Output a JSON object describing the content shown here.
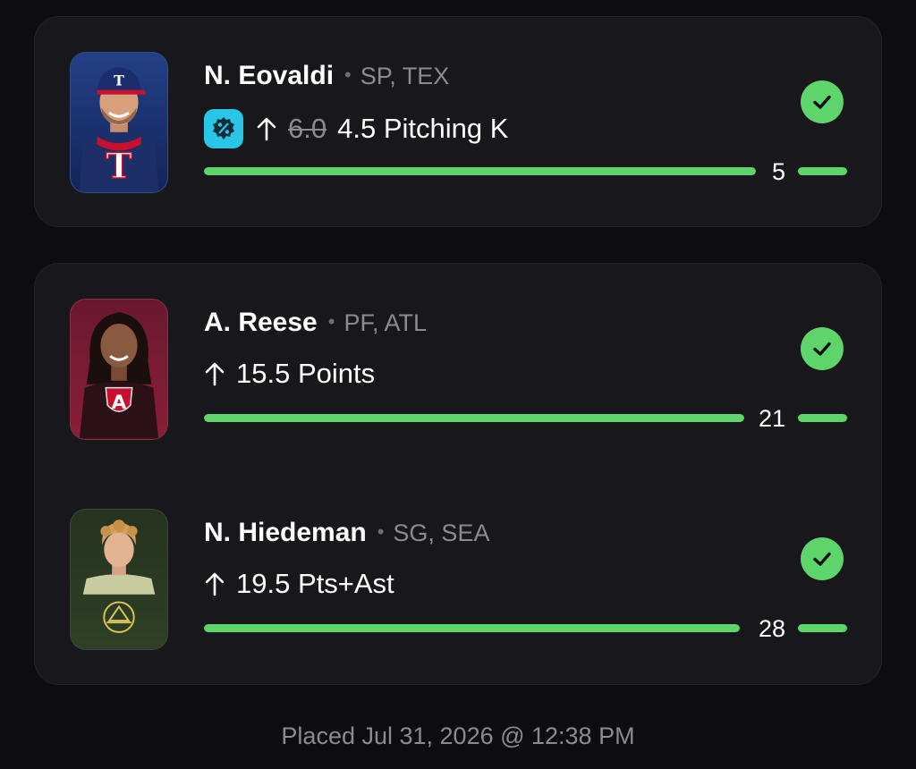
{
  "picks": [
    {
      "name": "N. Eovaldi",
      "meta": "SP, TEX",
      "promo_icon": "discount-badge-icon",
      "direction_icon": "arrow-up-icon",
      "old_line": "6.0",
      "line": "4.5",
      "stat": "Pitching K",
      "result": "5",
      "progress_fraction": 1.0,
      "status_icon": "check-circle-icon",
      "status_color": "#5dd56a"
    },
    {
      "name": "A. Reese",
      "meta": "PF, ATL",
      "direction_icon": "arrow-up-icon",
      "line": "15.5",
      "stat": "Points",
      "result": "21",
      "progress_fraction": 1.0,
      "status_icon": "check-circle-icon",
      "status_color": "#5dd56a"
    },
    {
      "name": "N. Hiedeman",
      "meta": "SG, SEA",
      "direction_icon": "arrow-up-icon",
      "line": "19.5",
      "stat": "Pts+Ast",
      "result": "28",
      "progress_fraction": 1.0,
      "status_icon": "check-circle-icon",
      "status_color": "#5dd56a"
    }
  ],
  "separator": "•",
  "footer": {
    "placed": "Placed Jul 31, 2026 @ 12:38 PM"
  },
  "colors": {
    "background": "#0d0d10",
    "card": "#18181c",
    "accent_green": "#5dd56a",
    "promo_cyan": "#29c6e8",
    "muted_text": "#8a8a92"
  }
}
